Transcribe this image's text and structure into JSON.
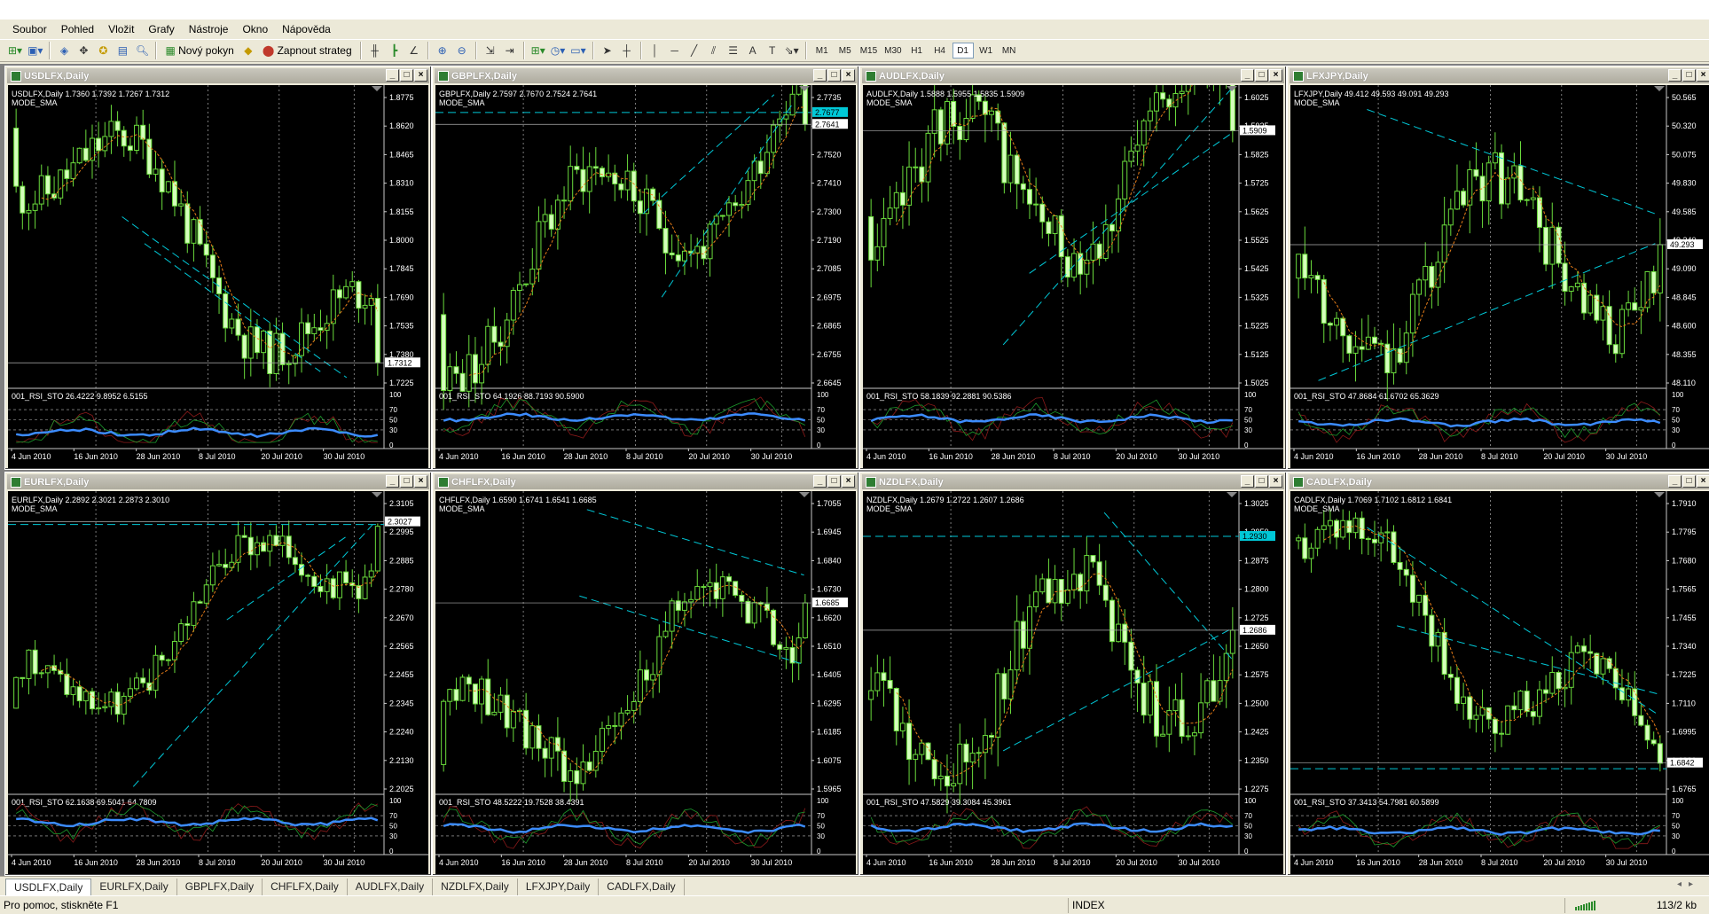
{
  "menu": [
    "Soubor",
    "Pohled",
    "Vložit",
    "Grafy",
    "Nástroje",
    "Okno",
    "Nápověda"
  ],
  "toolbar": {
    "new_order": "Nový pokyn",
    "autotrading": "Zapnout strateg",
    "timeframes": [
      "M1",
      "M5",
      "M15",
      "M30",
      "H1",
      "H4",
      "D1",
      "W1",
      "MN"
    ],
    "active_timeframe": "D1"
  },
  "charts": [
    {
      "title": "USDLFX,Daily",
      "info": "USDLFX,Daily  1.7360 1.7392 1.7267 1.7312",
      "mode": "MODE_SMA",
      "prices": [
        "1.8775",
        "1.8620",
        "1.8465",
        "1.8310",
        "1.8155",
        "1.8000",
        "1.7845",
        "1.7690",
        "1.7535",
        "1.7380",
        "1.7225"
      ],
      "ymax": 1.884,
      "ymin": 1.718,
      "last": "1.7312",
      "start": 1.862,
      "end": 1.7312,
      "volatility": 0.012,
      "seed": 11,
      "lines": [
        [
          0.3,
          0.43,
          0.9,
          0.97
        ],
        [
          0.36,
          0.52,
          0.83,
          0.95
        ]
      ],
      "hlines": [],
      "osc": "001_RSI_STO 26.4222 9.8952 6.5155",
      "osc_level": 0.25,
      "dates": [
        "4 Jun 2010",
        "16 Jun 2010",
        "28 Jun 2010",
        "8 Jul 2010",
        "20 Jul 2010",
        "30 Jul 2010"
      ],
      "accent": "#00c8d7"
    },
    {
      "title": "GBPLFX,Daily",
      "info": "GBPLFX,Daily  2.7597 2.7670 2.7524 2.7641",
      "mode": "MODE_SMA",
      "prices": [
        "2.7735",
        "2.7630",
        "2.7520",
        "2.7410",
        "2.7300",
        "2.7190",
        "2.7085",
        "2.6975",
        "2.6865",
        "2.6755",
        "2.6645"
      ],
      "ymax": 2.778,
      "ymin": 2.662,
      "last": "2.7641",
      "hl_price": "2.7677",
      "start": 2.69,
      "end": 2.7641,
      "volatility": 0.009,
      "seed": 23,
      "lines": [
        [
          0.55,
          0.42,
          0.9,
          0.02
        ],
        [
          0.6,
          0.7,
          0.95,
          0.05
        ]
      ],
      "hlines": [
        0.08
      ],
      "osc": "001_RSI_STO 64.1926 88.7193 90.5900",
      "osc_level": 0.55,
      "dates": [
        "4 Jun 2010",
        "16 Jun 2010",
        "28 Jun 2010",
        "8 Jul 2010",
        "20 Jul 2010",
        "30 Jul 2010"
      ],
      "accent": "#00c8d7"
    },
    {
      "title": "AUDLFX,Daily",
      "info": "AUDLFX,Daily  1.5888 1.5955 1.5835 1.5909",
      "mode": "MODE_SMA",
      "prices": [
        "1.6025",
        "1.5925",
        "1.5825",
        "1.5725",
        "1.5625",
        "1.5525",
        "1.5425",
        "1.5325",
        "1.5225",
        "1.5125",
        "1.5025"
      ],
      "ymax": 1.606,
      "ymin": 1.499,
      "last": "1.5909",
      "start": 1.56,
      "end": 1.5909,
      "volatility": 0.01,
      "seed": 37,
      "lines": [
        [
          0.37,
          0.86,
          0.98,
          0.0
        ],
        [
          0.44,
          0.62,
          0.98,
          0.15
        ]
      ],
      "hlines": [],
      "osc": "001_RSI_STO 58.1839 92.2881 90.5386",
      "osc_level": 0.52,
      "dates": [
        "4 Jun 2010",
        "16 Jun 2010",
        "28 Jun 2010",
        "8 Jul 2010",
        "20 Jul 2010",
        "30 Jul 2010"
      ],
      "accent": "#00c8d7"
    },
    {
      "title": "LFXJPY,Daily",
      "info": "LFXJPY,Daily  49.412 49.593 49.091 49.293",
      "mode": "MODE_SMA",
      "prices": [
        "50.565",
        "50.320",
        "50.075",
        "49.830",
        "49.585",
        "49.340",
        "49.090",
        "48.845",
        "48.600",
        "48.355",
        "48.110"
      ],
      "ymax": 50.66,
      "ymin": 48.05,
      "last": "49.293",
      "start": 49.0,
      "end": 49.293,
      "volatility": 0.25,
      "seed": 53,
      "lines": [
        [
          0.2,
          0.07,
          0.97,
          0.42
        ],
        [
          0.07,
          0.98,
          0.97,
          0.52
        ]
      ],
      "hlines": [],
      "osc": "001_RSI_STO 47.8684 61.6702 65.3629",
      "osc_level": 0.45,
      "dates": [
        "4 Jun 2010",
        "16 Jun 2010",
        "28 Jun 2010",
        "8 Jul 2010",
        "20 Jul 2010",
        "30 Jul 2010"
      ],
      "accent": "#00c8d7"
    },
    {
      "title": "EURLFX,Daily",
      "info": "EURLFX,Daily  2.2892 2.3021 2.2873 2.3010",
      "mode": "MODE_SMA",
      "prices": [
        "2.3105",
        "2.2995",
        "2.2885",
        "2.2780",
        "2.2670",
        "2.2565",
        "2.2455",
        "2.2345",
        "2.2240",
        "2.2130",
        "2.2025"
      ],
      "ymax": 2.313,
      "ymin": 2.2,
      "last": "2.3027",
      "start": 2.232,
      "end": 2.301,
      "volatility": 0.006,
      "seed": 71,
      "lines": [
        [
          0.33,
          0.98,
          0.97,
          0.1
        ],
        [
          0.58,
          0.42,
          0.9,
          0.14
        ]
      ],
      "hlines": [
        0.1
      ],
      "osc": "001_RSI_STO 62.1638 69.5041 64.7809",
      "osc_level": 0.58,
      "dates": [
        "4 Jun 2010",
        "16 Jun 2010",
        "28 Jun 2010",
        "8 Jul 2010",
        "20 Jul 2010",
        "30 Jul 2010"
      ],
      "accent": "#00c8d7"
    },
    {
      "title": "CHFLFX,Daily",
      "info": "CHFLFX,Daily  1.6590 1.6741 1.6541 1.6685",
      "mode": "MODE_SMA",
      "prices": [
        "1.7055",
        "1.6945",
        "1.6840",
        "1.6730",
        "1.6620",
        "1.6510",
        "1.6405",
        "1.6295",
        "1.6185",
        "1.6075",
        "1.5965"
      ],
      "ymax": 1.711,
      "ymin": 1.594,
      "last": "1.6685",
      "start": 1.605,
      "end": 1.6685,
      "volatility": 0.008,
      "seed": 89,
      "lines": [
        [
          0.4,
          0.05,
          0.98,
          0.27
        ],
        [
          0.38,
          0.34,
          0.98,
          0.57
        ]
      ],
      "hlines": [],
      "osc": "001_RSI_STO 48.5222 19.7528 38.4391",
      "osc_level": 0.45,
      "dates": [
        "4 Jun 2010",
        "16 Jun 2010",
        "28 Jun 2010",
        "8 Jul 2010",
        "20 Jul 2010",
        "30 Jul 2010"
      ],
      "accent": "#00c8d7"
    },
    {
      "title": "NZDLFX,Daily",
      "info": "NZDLFX,Daily  1.2679 1.2722 1.2607 1.2686",
      "mode": "MODE_SMA",
      "prices": [
        "1.3025",
        "1.2950",
        "1.2875",
        "1.2800",
        "1.2725",
        "1.2650",
        "1.2575",
        "1.2500",
        "1.2425",
        "1.2350",
        "1.2275"
      ],
      "ymax": 1.305,
      "ymin": 1.225,
      "last": "1.2686",
      "hl_price": "1.2930",
      "start": 1.25,
      "end": 1.2686,
      "volatility": 0.008,
      "seed": 97,
      "lines": [
        [
          0.37,
          0.86,
          0.98,
          0.45
        ],
        [
          0.64,
          0.06,
          0.98,
          0.55
        ]
      ],
      "hlines": [
        0.14
      ],
      "osc": "001_RSI_STO 47.5829 39.3084 45.3961",
      "osc_level": 0.46,
      "dates": [
        "4 Jun 2010",
        "16 Jun 2010",
        "28 Jun 2010",
        "8 Jul 2010",
        "20 Jul 2010",
        "30 Jul 2010"
      ],
      "accent": "#00c8d7"
    },
    {
      "title": "CADLFX,Daily",
      "info": "CADLFX,Daily  1.7069 1.7102 1.6812 1.6841",
      "mode": "MODE_SMA",
      "prices": [
        "1.7910",
        "1.7795",
        "1.7680",
        "1.7565",
        "1.7455",
        "1.7340",
        "1.7225",
        "1.7110",
        "1.6995",
        "1.6880",
        "1.6765"
      ],
      "ymax": 1.795,
      "ymin": 1.672,
      "last": "1.6842",
      "start": 1.776,
      "end": 1.6841,
      "volatility": 0.008,
      "seed": 113,
      "lines": [
        [
          0.2,
          0.11,
          0.98,
          0.74
        ],
        [
          0.28,
          0.44,
          0.98,
          0.67
        ]
      ],
      "hlines": [
        0.92
      ],
      "osc": "001_RSI_STO 37.3413 54.7981 60.5899",
      "osc_level": 0.4,
      "dates": [
        "4 Jun 2010",
        "16 Jun 2010",
        "28 Jun 2010",
        "8 Jul 2010",
        "20 Jul 2010",
        "30 Jul 2010"
      ],
      "accent": "#00c8d7"
    }
  ],
  "osc_scale": [
    "100",
    "70",
    "50",
    "30",
    "0"
  ],
  "tabs": [
    "USDLFX,Daily",
    "EURLFX,Daily",
    "GBPLFX,Daily",
    "CHFLFX,Daily",
    "AUDLFX,Daily",
    "NZDLFX,Daily",
    "LFXJPY,Daily",
    "CADLFX,Daily"
  ],
  "active_tab": 0,
  "status": {
    "help": "Pro pomoc, stiskněte F1",
    "profile": "INDEX",
    "kb": "113/2 kb"
  }
}
